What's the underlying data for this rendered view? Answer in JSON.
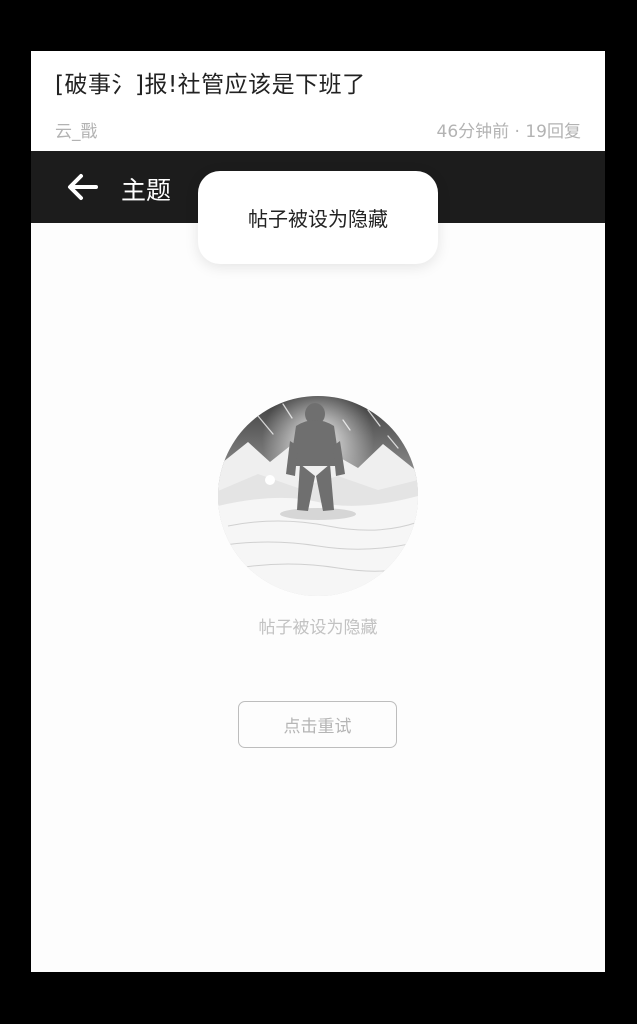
{
  "post": {
    "title": "[破事氵]报!社管应该是下班了",
    "author": "云_戬",
    "meta": "46分钟前 · 19回复"
  },
  "topbar": {
    "back_icon": "arrow-left-icon",
    "title": "主题"
  },
  "toast": {
    "message": "帖子被设为隐藏"
  },
  "empty_state": {
    "illustration": "lone-figure-snow-mountain-illustration",
    "message": "帖子被设为隐藏",
    "retry_label": "点击重试"
  },
  "colors": {
    "topbar_bg": "#1c1c1c",
    "page_bg": "#fdfdfd",
    "muted_text": "#b3b3b3"
  }
}
